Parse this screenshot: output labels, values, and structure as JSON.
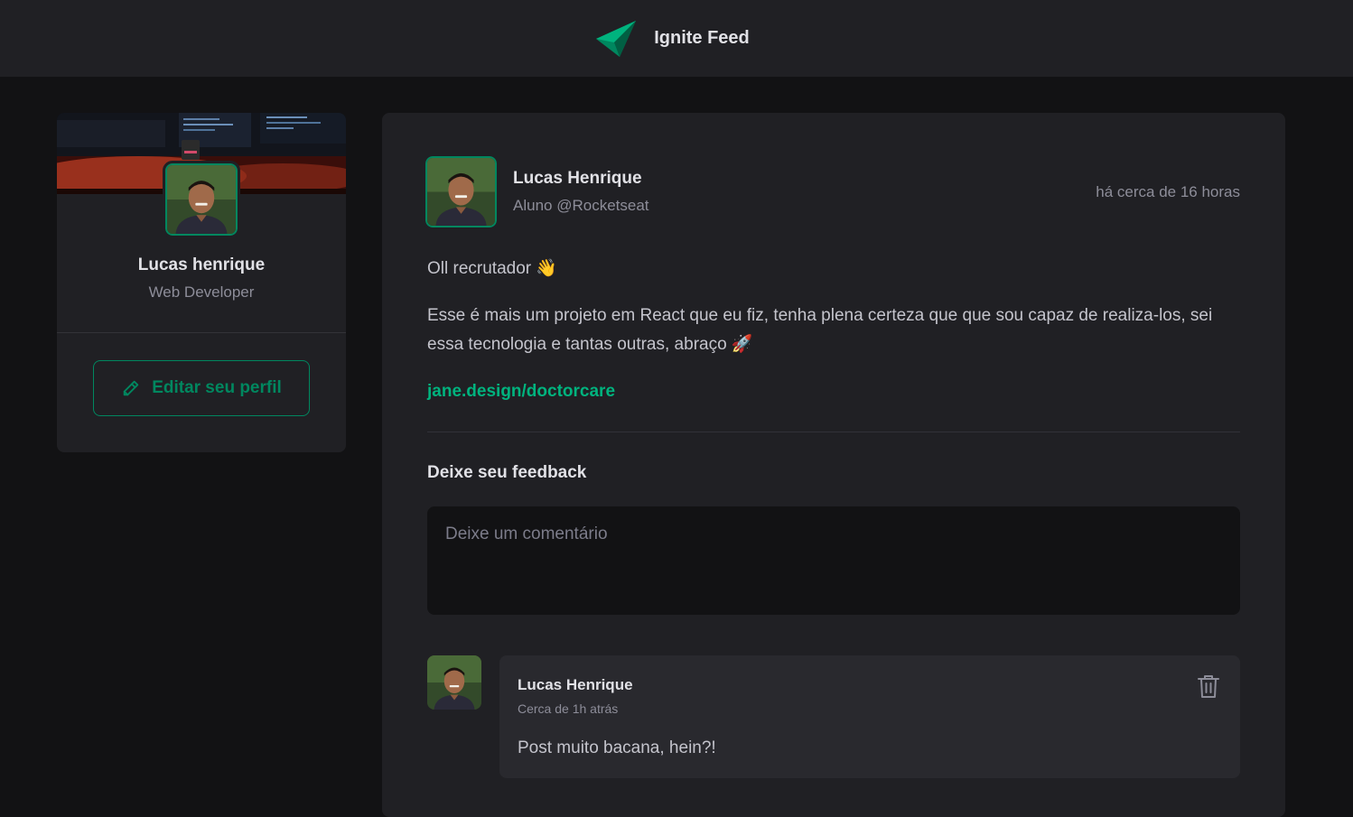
{
  "header": {
    "app_title": "Ignite Feed",
    "brand_color": "#00b37e"
  },
  "sidebar": {
    "cover_image": "desk-setup-cover",
    "avatar": "user-avatar",
    "name": "Lucas henrique",
    "role": "Web Developer",
    "edit_button_label": "Editar seu perfil",
    "edit_icon": "pencil-icon"
  },
  "post": {
    "author": {
      "name": "Lucas Henrique",
      "role": "Aluno @Rocketseat",
      "avatar": "user-avatar"
    },
    "published_at": "há cerca de 16 horas",
    "content": {
      "greeting": "Oll recrutador 👋",
      "body": "Esse é mais um projeto em React que eu fiz, tenha plena certeza que que sou capaz de realiza-los, sei essa tecnologia e tantas outras, abraço 🚀",
      "link": "jane.design/doctorcare"
    },
    "feedback": {
      "title": "Deixe seu feedback",
      "placeholder": "Deixe um comentário",
      "value": ""
    },
    "comments": [
      {
        "author": "Lucas Henrique",
        "time": "Cerca de 1h atrás",
        "text": "Post muito bacana, hein?!",
        "delete_icon": "trash-icon"
      }
    ]
  },
  "colors": {
    "background": "#121214",
    "surface": "#202024",
    "comment_surface": "#29292e",
    "accent": "#00875f",
    "accent_light": "#00b37e",
    "text": "#e1e1e6",
    "muted": "#8d8d99"
  }
}
